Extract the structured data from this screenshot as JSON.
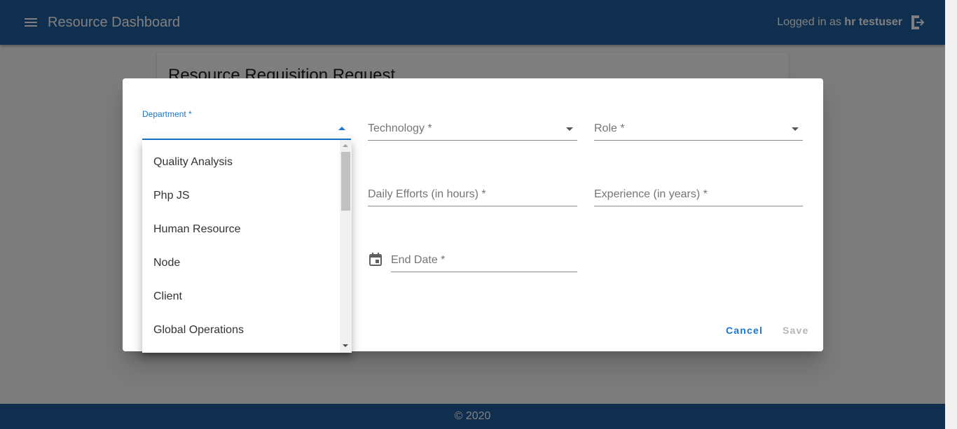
{
  "header": {
    "title": "Resource Dashboard",
    "logged_prefix": "Logged in as",
    "username": "hr testuser",
    "bg_color": "#215f9e"
  },
  "page": {
    "card_title": "Resource Requisition Request"
  },
  "dialog": {
    "department_label": "Department *",
    "technology_label": "Technology *",
    "role_label": "Role *",
    "daily_efforts_label": "Daily Efforts (in hours) *",
    "experience_label": "Experience (in years) *",
    "end_date_label": "End Date *",
    "cancel_label": "Cancel",
    "save_label": "Save"
  },
  "department_options": [
    "Quality Analysis",
    "Php JS",
    "Human Resource",
    "Node",
    "Client",
    "Global Operations"
  ],
  "footer": {
    "copyright": "© 2020"
  },
  "icons": {
    "menu": "menu-icon",
    "logout": "logout-icon",
    "calendar": "calendar-icon"
  }
}
